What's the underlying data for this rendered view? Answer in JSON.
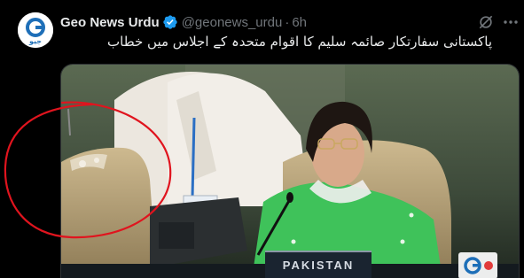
{
  "tweet": {
    "display_name": "Geo News Urdu",
    "handle": "@geonews_urdu",
    "separator": "·",
    "time": "6h",
    "text": "پاکستانی سفارتکار صائمہ سلیم کا اقوام متحدہ کے اجلاس میں خطاب"
  },
  "avatar": {
    "logo_text": "جیو"
  },
  "media": {
    "nameplate_text": "PAKISTAN",
    "broadcaster_bug": "geo-logo"
  },
  "icons": {
    "verified": "verified-badge-icon",
    "grok": "grok-icon",
    "more": "more-icon"
  },
  "colors": {
    "background": "#000000",
    "text_primary": "#e7e9ea",
    "text_secondary": "#71767b",
    "verified": "#1d9bf0",
    "annotation": "#e0141e",
    "dress_green": "#3fc25a"
  }
}
